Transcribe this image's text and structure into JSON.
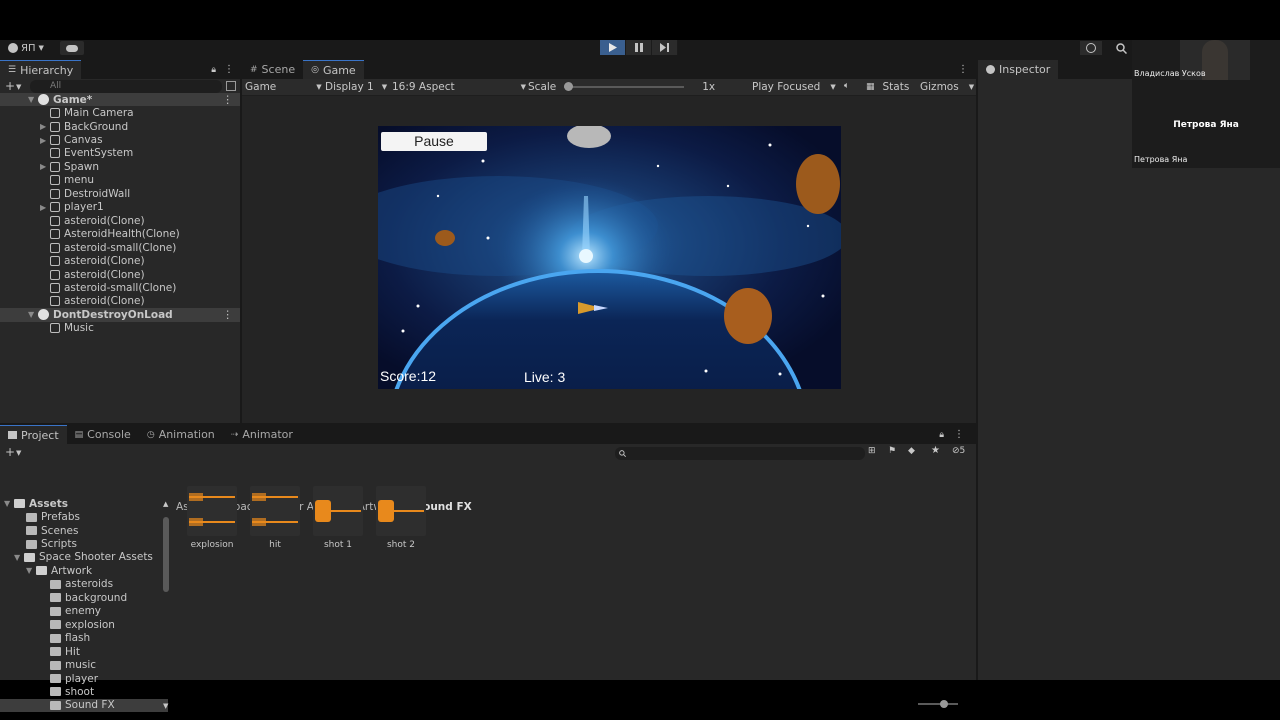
{
  "toolbar": {
    "account_label": "ЯП",
    "cloud_icon": "cloud-icon",
    "play_icon": "play-icon",
    "pause_icon": "pause-icon",
    "step_icon": "step-icon"
  },
  "hierarchy": {
    "tab_label": "Hierarchy",
    "search_placeholder": "All",
    "items": [
      {
        "label": "Game*",
        "level": 0,
        "type": "scene"
      },
      {
        "label": "Main Camera",
        "level": 1,
        "type": "object"
      },
      {
        "label": "BackGround",
        "level": 1,
        "type": "object",
        "collapsed": true
      },
      {
        "label": "Canvas",
        "level": 1,
        "type": "object",
        "collapsed": true
      },
      {
        "label": "EventSystem",
        "level": 1,
        "type": "object"
      },
      {
        "label": "Spawn",
        "level": 1,
        "type": "object",
        "collapsed": true
      },
      {
        "label": "menu",
        "level": 1,
        "type": "object"
      },
      {
        "label": "DestroidWall",
        "level": 1,
        "type": "object"
      },
      {
        "label": "player1",
        "level": 1,
        "type": "object",
        "collapsed": true
      },
      {
        "label": "asteroid(Clone)",
        "level": 1,
        "type": "object"
      },
      {
        "label": "AsteroidHealth(Clone)",
        "level": 1,
        "type": "object"
      },
      {
        "label": "asteroid-small(Clone)",
        "level": 1,
        "type": "object"
      },
      {
        "label": "asteroid(Clone)",
        "level": 1,
        "type": "object"
      },
      {
        "label": "asteroid(Clone)",
        "level": 1,
        "type": "object"
      },
      {
        "label": "asteroid-small(Clone)",
        "level": 1,
        "type": "object"
      },
      {
        "label": "asteroid(Clone)",
        "level": 1,
        "type": "object"
      },
      {
        "label": "DontDestroyOnLoad",
        "level": 0,
        "type": "scene"
      },
      {
        "label": "Music",
        "level": 1,
        "type": "object"
      }
    ]
  },
  "game_panel": {
    "tabs": [
      {
        "label": "Scene",
        "active": false
      },
      {
        "label": "Game",
        "active": true
      }
    ],
    "toolbar": {
      "mode": "Game",
      "display": "Display 1",
      "aspect": "16:9 Aspect",
      "scale_label": "Scale",
      "scale_value": "1x",
      "play_focused": "Play Focused",
      "stats": "Stats",
      "gizmos": "Gizmos"
    },
    "game": {
      "pause_button": "Pause",
      "score": "Score:12",
      "lives": "Live: 3"
    }
  },
  "inspector": {
    "tab_label": "Inspector"
  },
  "video_call": {
    "participant_1": "Владислав Усков",
    "participant_2_center": "Петрова Яна",
    "participant_2": "Петрова Яна"
  },
  "bottom_panel": {
    "tabs": [
      {
        "label": "Project",
        "active": true
      },
      {
        "label": "Console",
        "active": false
      },
      {
        "label": "Animation",
        "active": false
      },
      {
        "label": "Animator",
        "active": false
      }
    ],
    "badge_count": "5",
    "breadcrumb": [
      "Assets",
      "Space Shooter Assets",
      "Artwork",
      "Sound FX"
    ],
    "tree": [
      {
        "label": "Assets",
        "level": 0,
        "bold": true
      },
      {
        "label": "Prefabs",
        "level": 1
      },
      {
        "label": "Scenes",
        "level": 1
      },
      {
        "label": "Scripts",
        "level": 1
      },
      {
        "label": "Space Shooter Assets",
        "level": 1
      },
      {
        "label": "Artwork",
        "level": 2
      },
      {
        "label": "asteroids",
        "level": 3
      },
      {
        "label": "background",
        "level": 3
      },
      {
        "label": "enemy",
        "level": 3
      },
      {
        "label": "explosion",
        "level": 3
      },
      {
        "label": "flash",
        "level": 3
      },
      {
        "label": "Hit",
        "level": 3
      },
      {
        "label": "music",
        "level": 3
      },
      {
        "label": "player",
        "level": 3
      },
      {
        "label": "shoot",
        "level": 3
      },
      {
        "label": "Sound FX",
        "level": 3
      }
    ],
    "assets": [
      {
        "label": "explosion"
      },
      {
        "label": "hit"
      },
      {
        "label": "shot 1"
      },
      {
        "label": "shot 2"
      }
    ]
  },
  "colors": {
    "accent": "#3a74c8",
    "waveform": "#e8891c"
  }
}
